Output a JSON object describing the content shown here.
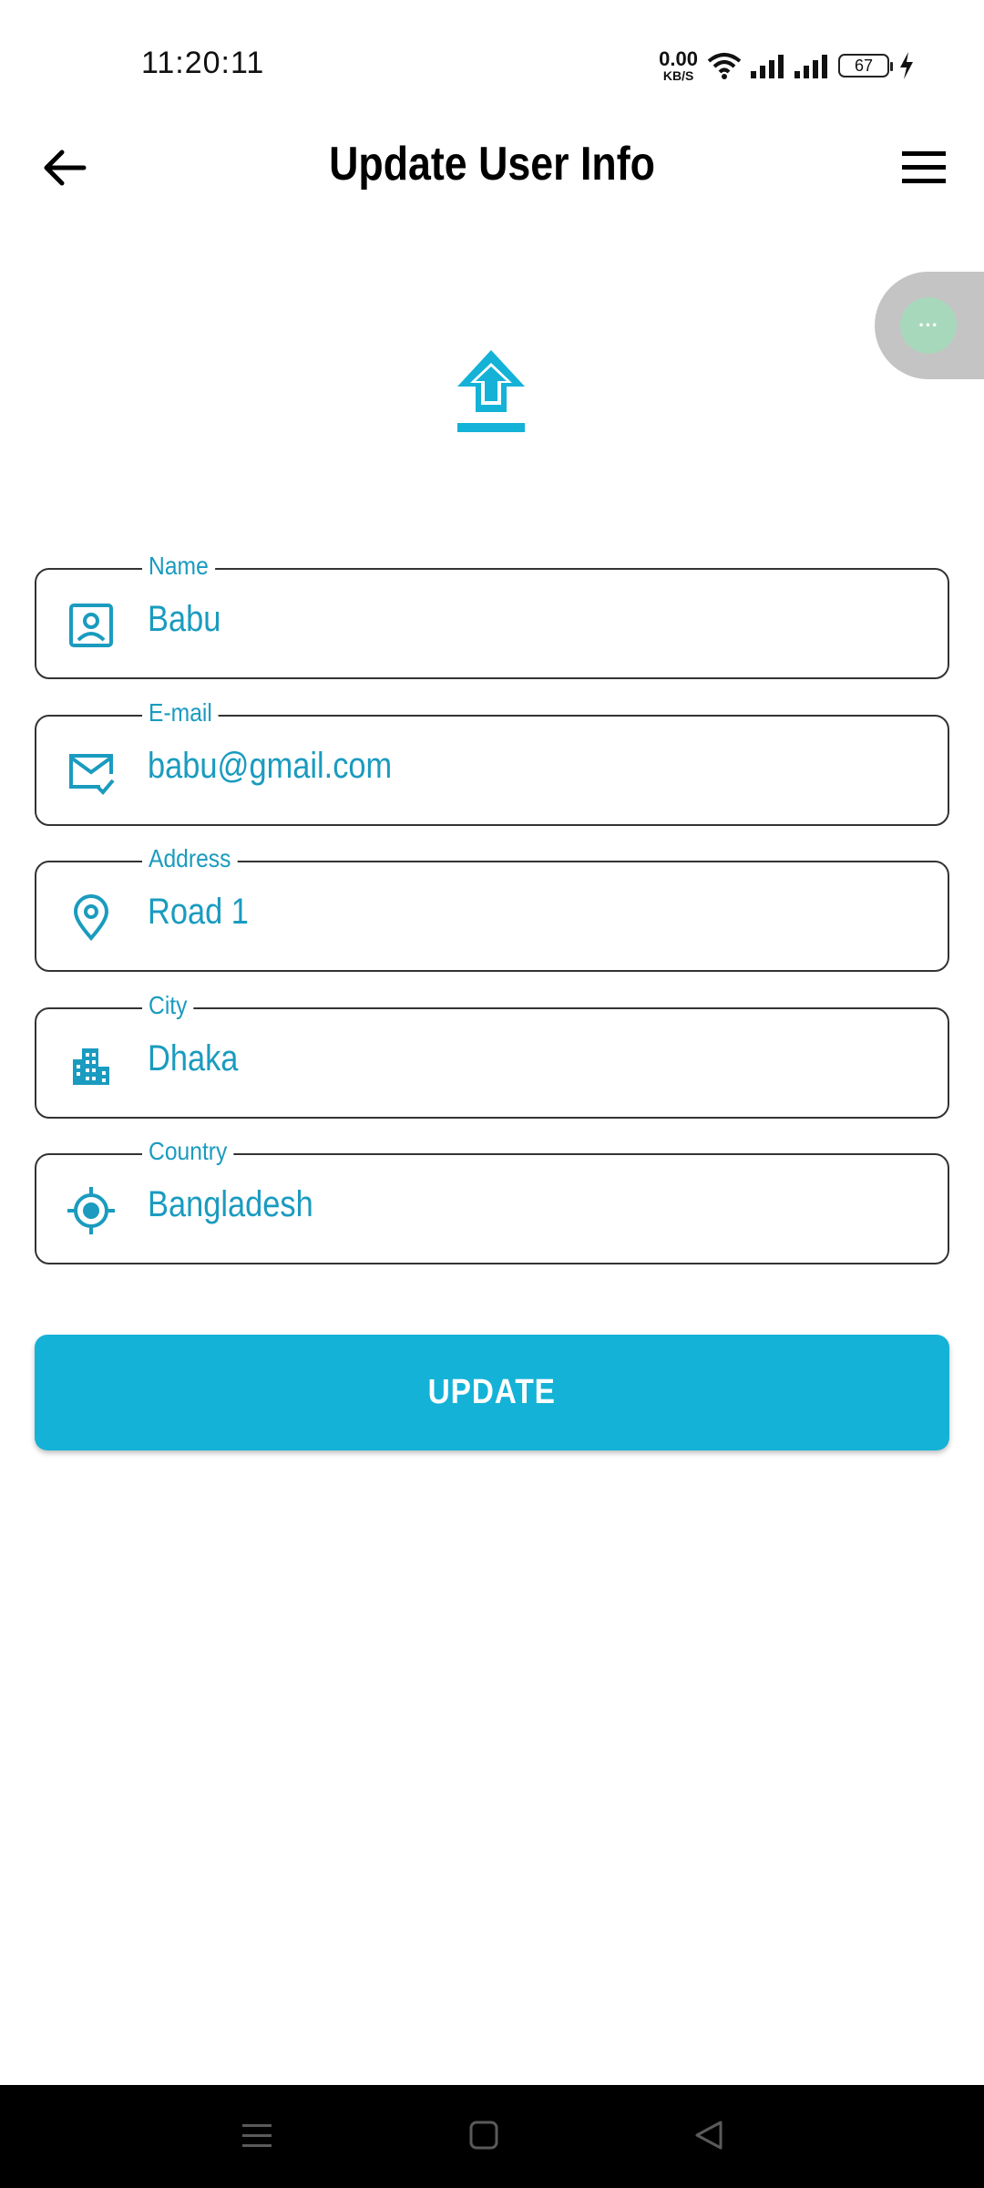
{
  "status_bar": {
    "time": "11:20:11",
    "net_speed_value": "0.00",
    "net_speed_unit": "KB/S",
    "battery_level": "67"
  },
  "header": {
    "title": "Update User Info"
  },
  "fields": [
    {
      "label": "Name",
      "value": "Babu",
      "icon": "contact-card-icon"
    },
    {
      "label": "E-mail",
      "value": "babu@gmail.com",
      "icon": "mail-check-icon"
    },
    {
      "label": "Address",
      "value": "Road 1",
      "icon": "location-pin-icon"
    },
    {
      "label": "City",
      "value": "Dhaka",
      "icon": "city-buildings-icon"
    },
    {
      "label": "Country",
      "value": "Bangladesh",
      "icon": "crosshair-location-icon"
    }
  ],
  "actions": {
    "update_label": "UPDATE"
  },
  "floating_bubble": {
    "label": "···"
  },
  "colors": {
    "accent": "#14b2d7",
    "field_text": "#1a9bbf",
    "nav_background": "#000000"
  }
}
